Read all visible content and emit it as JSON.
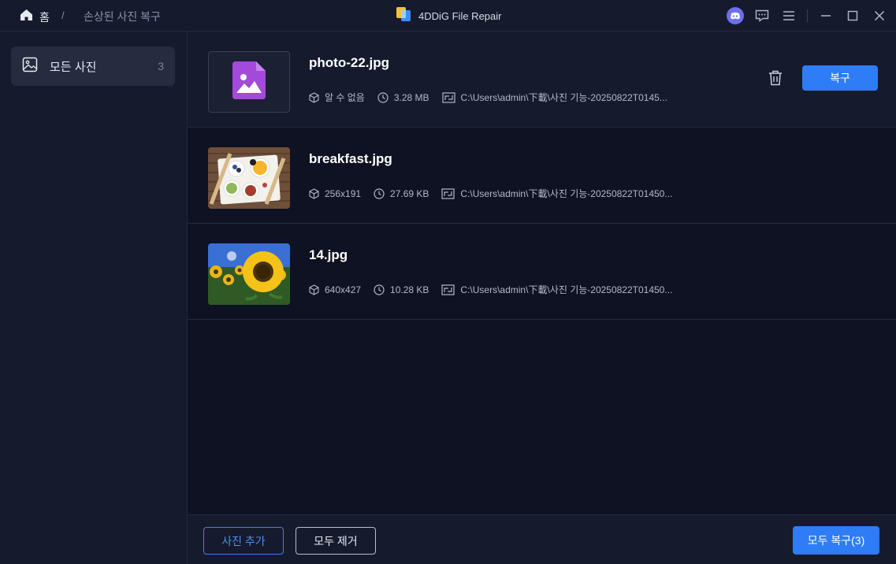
{
  "titlebar": {
    "home_label": "홈",
    "separator": "/",
    "current_page": "손상된 사진 복구",
    "app_name": "4DDiG File Repair"
  },
  "sidebar": {
    "items": [
      {
        "label": "모든 사진",
        "count": "3",
        "icon": "image-icon"
      }
    ]
  },
  "files": [
    {
      "name": "photo-22.jpg",
      "resolution": "알 수 없음",
      "size": "3.28 MB",
      "path": "C:\\Users\\admin\\下載\\사진 기능-20250822T0145...",
      "thumbnail": "placeholder",
      "selected": true
    },
    {
      "name": "breakfast.jpg",
      "resolution": "256x191",
      "size": "27.69 KB",
      "path": "C:\\Users\\admin\\下載\\사진 기능-20250822T01450...",
      "thumbnail": "breakfast",
      "selected": false
    },
    {
      "name": "14.jpg",
      "resolution": "640x427",
      "size": "10.28 KB",
      "path": "C:\\Users\\admin\\下載\\사진 기능-20250822T01450...",
      "thumbnail": "sunflower",
      "selected": false
    }
  ],
  "row_actions": {
    "recover_label": "복구"
  },
  "footer": {
    "add_label": "사진 추가",
    "clear_label": "모두 제거",
    "recover_all_label": "모두 복구(3)"
  },
  "colors": {
    "accent": "#2e7cf6",
    "background": "#0f1222",
    "panel": "#161a2d",
    "placeholder_icon": "#a34bd8"
  }
}
